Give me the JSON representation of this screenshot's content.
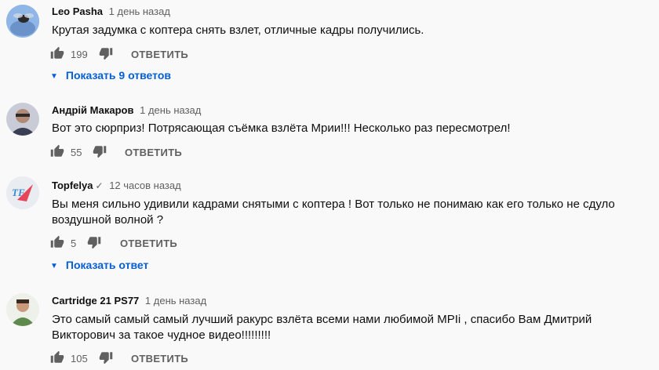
{
  "comments": [
    {
      "author": "Leo Pasha",
      "time": "1 день назад",
      "text": "Крутая задумка с коптера снять взлет, отличные кадры получились.",
      "likes": "199",
      "reply_label": "ОТВЕТИТЬ",
      "show_replies": "Показать 9 ответов"
    },
    {
      "author": "Андрій Макаров",
      "time": "1 день назад",
      "text": "Вот это сюрприз! Потрясающая съёмка взлёта Мрии!!! Несколько раз пересмотрел!",
      "likes": "55",
      "reply_label": "ОТВЕТИТЬ"
    },
    {
      "author": "Topfelya",
      "time": "12 часов назад",
      "avatar_text": "TF",
      "text": "Вы меня сильно удивили кадрами снятыми с коптера ! Вот только не понимаю как его только не сдуло воздушной волной ?",
      "likes": "5",
      "reply_label": "ОТВЕТИТЬ",
      "show_replies": "Показать ответ"
    },
    {
      "author": "Cartridge 21 PS77",
      "time": "1 день назад",
      "text": "Это самый самый самый лучший ракурс взлёта всеми нами любимой МРІі , спасибо Вам Дмитрий Викторович за такое чудное видео!!!!!!!!!",
      "likes": "105",
      "reply_label": "ОТВЕТИТЬ"
    }
  ],
  "colors": {
    "link": "#065fd4",
    "secondary": "#606060",
    "text": "#0f0f0f"
  }
}
